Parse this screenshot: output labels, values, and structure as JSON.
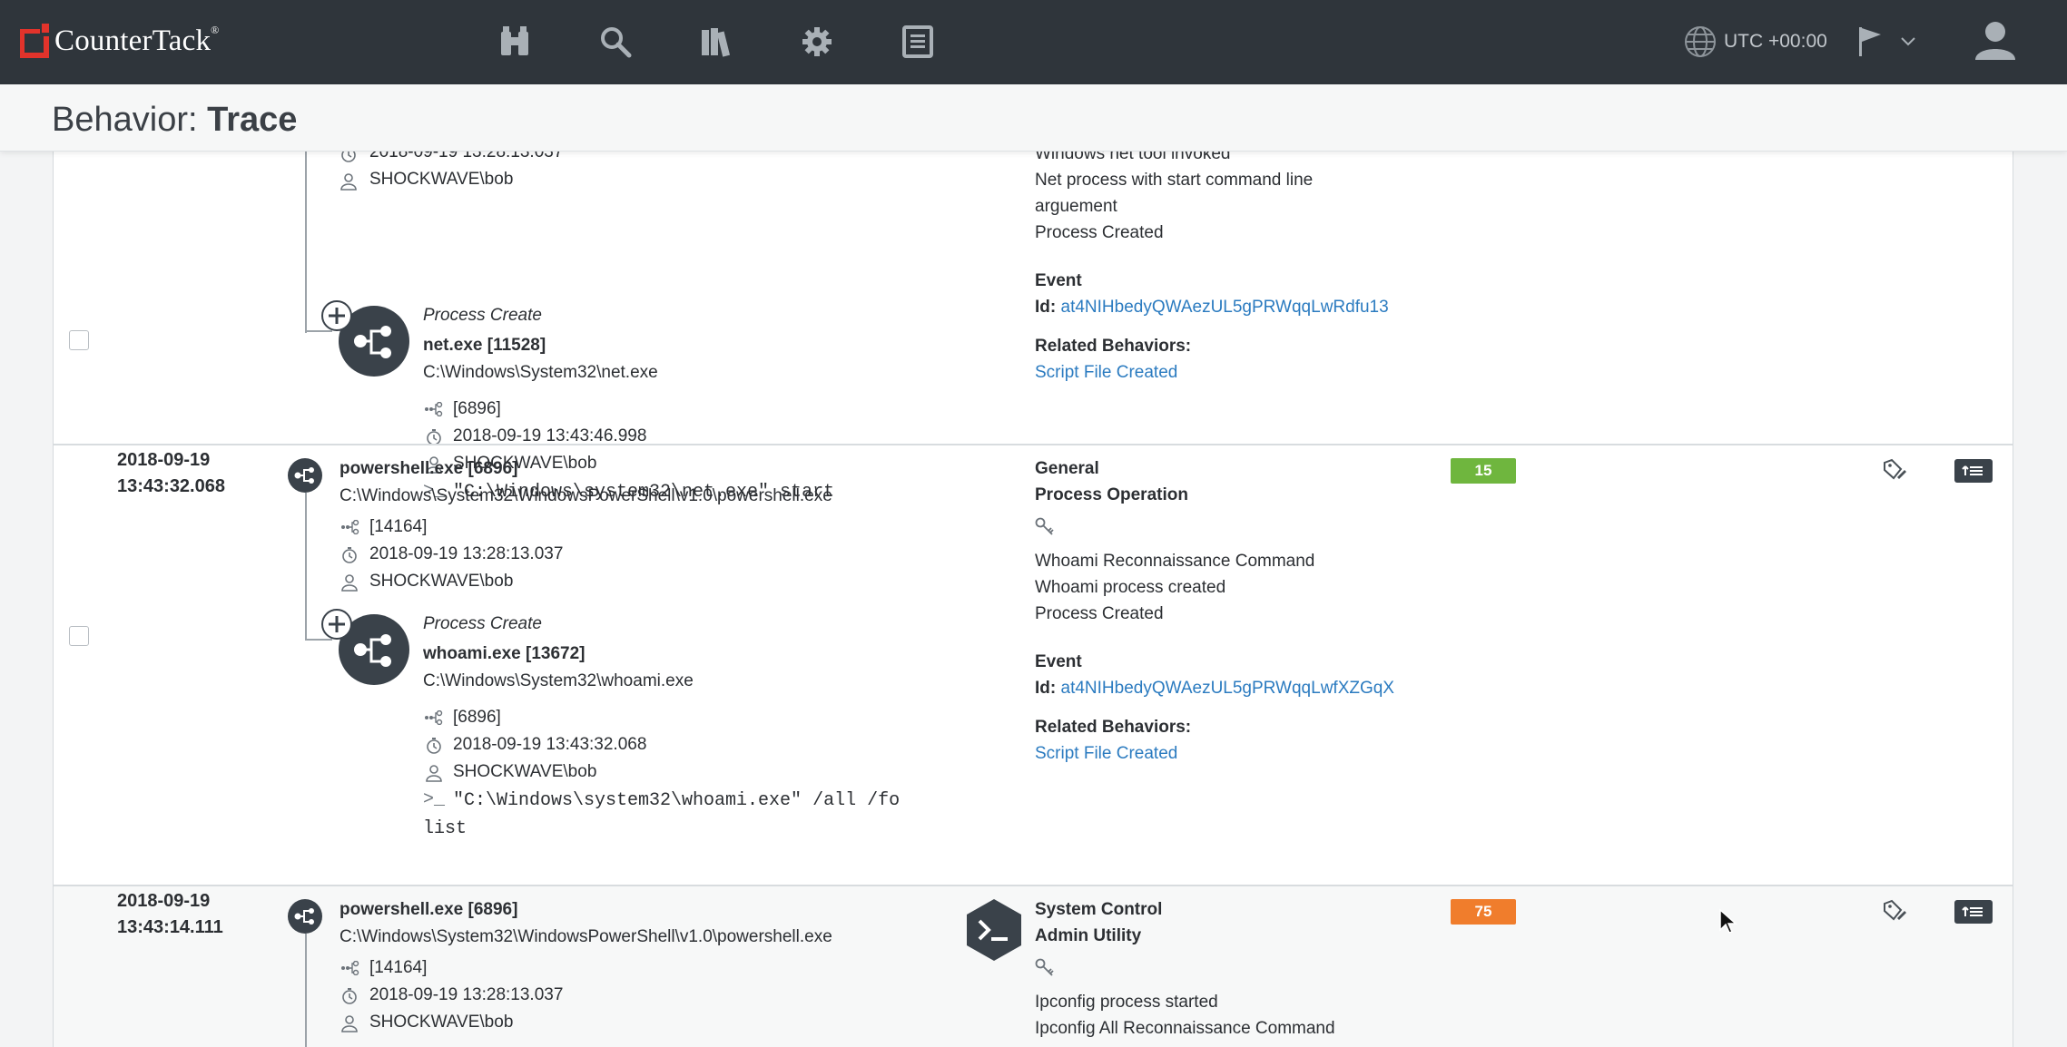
{
  "brand": {
    "name": "CounterTack",
    "trademark": "®"
  },
  "nav": {
    "timezone": "UTC +00:00"
  },
  "page": {
    "title_prefix": "Behavior:",
    "title_main": "Trace"
  },
  "colors": {
    "topbar": "#2f353b",
    "link": "#2b7bc0",
    "score_green": "#6fb63e",
    "score_orange": "#f07d2c",
    "brand_red": "#e2332b"
  },
  "rows": [
    {
      "parent": {
        "timestamp": "2018-09-19 13:28:13.037",
        "user": "SHOCKWAVE\\bob"
      },
      "child": {
        "type": "Process Create",
        "name": "net.exe [11528]",
        "path": "C:\\Windows\\System32\\net.exe",
        "ppid": "[6896]",
        "timestamp": "2018-09-19 13:43:46.998",
        "user": "SHOCKWAVE\\bob",
        "cmd_lines": [
          "\"C:\\Windows\\system32\\net.exe\" start"
        ]
      },
      "details": {
        "items": [
          "Windows net tool invoked",
          "Net process with start command line",
          "arguement",
          "Process Created"
        ],
        "event_heading": "Event",
        "id_label": "Id:",
        "event_id": "at4NIHbedyQWAezUL5gPRWqqLwRdfu13",
        "related_heading": "Related Behaviors:",
        "related": "Script File Created"
      }
    },
    {
      "date": "2018-09-19",
      "time": "13:43:32.068",
      "parent": {
        "name": "powershell.exe [6896]",
        "path": "C:\\Windows\\System32\\WindowsPowerShell\\v1.0\\powershell.exe",
        "ppid": "[14164]",
        "timestamp": "2018-09-19 13:28:13.037",
        "user": "SHOCKWAVE\\bob"
      },
      "child": {
        "type": "Process Create",
        "name": "whoami.exe [13672]",
        "path": "C:\\Windows\\System32\\whoami.exe",
        "ppid": "[6896]",
        "timestamp": "2018-09-19 13:43:32.068",
        "user": "SHOCKWAVE\\bob",
        "cmd_lines": [
          "\"C:\\Windows\\system32\\whoami.exe\" /all /fo",
          "list"
        ]
      },
      "details": {
        "category": "General",
        "subcategory": "Process Operation",
        "items": [
          "Whoami Reconnaissance Command",
          "Whoami process created",
          "Process Created"
        ],
        "event_heading": "Event",
        "id_label": "Id:",
        "event_id": "at4NIHbedyQWAezUL5gPRWqqLwfXZGqX",
        "related_heading": "Related Behaviors:",
        "related": "Script File Created"
      },
      "score": "15",
      "score_color": "#6fb63e"
    },
    {
      "date": "2018-09-19",
      "time": "13:43:14.111",
      "parent": {
        "name": "powershell.exe [6896]",
        "path": "C:\\Windows\\System32\\WindowsPowerShell\\v1.0\\powershell.exe",
        "ppid": "[14164]",
        "timestamp": "2018-09-19 13:28:13.037",
        "user": "SHOCKWAVE\\bob"
      },
      "details": {
        "category": "System Control",
        "subcategory": "Admin Utility",
        "items": [
          "Ipconfig process started",
          "Ipconfig All Reconnaissance Command"
        ]
      },
      "score": "75",
      "score_color": "#f07d2c"
    }
  ]
}
